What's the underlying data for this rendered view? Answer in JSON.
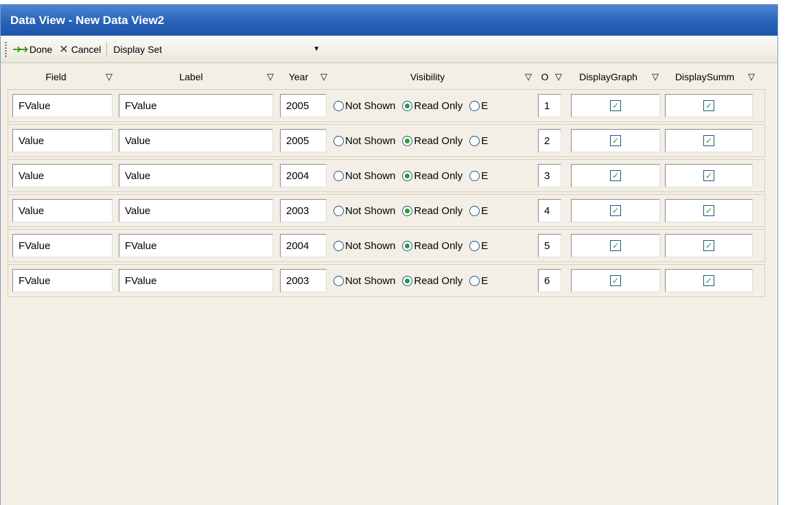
{
  "window": {
    "title": "Data View  - New Data View2"
  },
  "toolbar": {
    "done_label": "Done",
    "cancel_label": "Cancel",
    "display_set_label": "Display Set",
    "display_set_value": ""
  },
  "columns": {
    "field": "Field",
    "label": "Label",
    "year": "Year",
    "visibility": "Visibility",
    "order": "O",
    "display_graph": "DisplayGraph",
    "display_summ": "DisplaySumm"
  },
  "visibility_options": {
    "not_shown": "Not Shown",
    "read_only": "Read Only",
    "editable": "E"
  },
  "rows": [
    {
      "field": "FValue",
      "label": "FValue",
      "year": "2005",
      "visibility": "Read Only",
      "order": "1",
      "display_graph": true,
      "display_summ": true
    },
    {
      "field": "Value",
      "label": "Value",
      "year": "2005",
      "visibility": "Read Only",
      "order": "2",
      "display_graph": true,
      "display_summ": true
    },
    {
      "field": "Value",
      "label": "Value",
      "year": "2004",
      "visibility": "Read Only",
      "order": "3",
      "display_graph": true,
      "display_summ": true
    },
    {
      "field": "Value",
      "label": "Value",
      "year": "2003",
      "visibility": "Read Only",
      "order": "4",
      "display_graph": true,
      "display_summ": true
    },
    {
      "field": "FValue",
      "label": "FValue",
      "year": "2004",
      "visibility": "Read Only",
      "order": "5",
      "display_graph": true,
      "display_summ": true
    },
    {
      "field": "FValue",
      "label": "FValue",
      "year": "2003",
      "visibility": "Read Only",
      "order": "6",
      "display_graph": true,
      "display_summ": true
    }
  ],
  "icons": {
    "done": "double-arrow-icon",
    "cancel": "x-icon",
    "filter": "funnel-icon",
    "dropdown": "chevron-down-icon"
  },
  "colors": {
    "titlebar": "#2a62b8",
    "window_bg": "#f3efe6",
    "accent_green": "#21a121"
  }
}
